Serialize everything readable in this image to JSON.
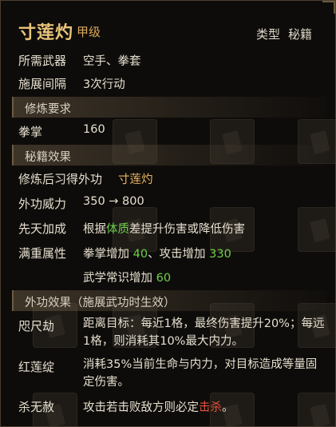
{
  "header": {
    "name": "寸莲灼",
    "grade": "甲级",
    "type_label": "类型",
    "type_value": "秘籍"
  },
  "requirements": {
    "weapon_label": "所需武器",
    "weapon_value": "空手、拳套",
    "interval_label": "施展间隔",
    "interval_value": "3次行动"
  },
  "cultivation": {
    "section_title": "修炼要求",
    "stat_label": "拳掌",
    "stat_value": "160"
  },
  "effects": {
    "section_title": "秘籍效果",
    "learn_label": "修炼后习得外功",
    "learn_value": "寸莲灼",
    "power_label": "外功威力",
    "power_value": "350 → 800",
    "innate_label": "先天加成",
    "innate_pre": "根据",
    "innate_attr": "体质",
    "innate_post": "差提升伤害或降低伤害",
    "full_label": "满重属性",
    "full_line1_a": "拳掌增加 ",
    "full_line1_b": "40",
    "full_line1_c": "、攻击增加 ",
    "full_line1_d": "330",
    "full_line2_a": "武学常识增加 ",
    "full_line2_b": "60"
  },
  "external": {
    "section_title": "外功效果（施展武功时生效）",
    "items": [
      {
        "name": "咫尺劫",
        "desc": "距离目标：每近1格，最终伤害提升20%；每远1格，则消耗其10%最大内力。"
      },
      {
        "name": "红莲绽",
        "desc": "消耗35%当前生命与内力，对目标造成等量固定伤害。"
      }
    ],
    "kill_name": "杀无赦",
    "kill_pre": "攻击若击败敌方则必定",
    "kill_highlight": "击杀",
    "kill_post": "。"
  },
  "colors": {
    "title": "#e8c37a",
    "highlight_gold": "#e8b55e",
    "highlight_green": "#6fcf4a",
    "highlight_red": "#e5533a"
  }
}
